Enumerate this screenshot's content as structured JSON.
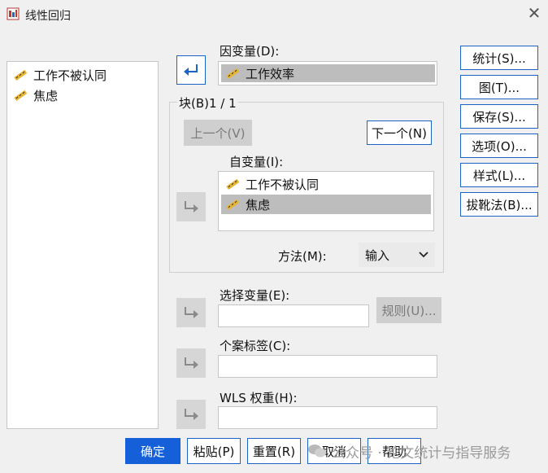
{
  "window": {
    "title": "线性回归",
    "close_glyph": "✕"
  },
  "source_list": {
    "items": [
      {
        "label": "工作不被认同"
      },
      {
        "label": "焦虑"
      }
    ]
  },
  "dependent": {
    "label": "因变量(D):",
    "value": "工作效率"
  },
  "block": {
    "label": "块(B)1 / 1",
    "prev": "上一个(V)",
    "next": "下一个(N)"
  },
  "independent": {
    "label": "自变量(I):",
    "items": [
      {
        "label": "工作不被认同"
      },
      {
        "label": "焦虑"
      }
    ]
  },
  "method": {
    "label": "方法(M):",
    "value": "输入"
  },
  "selection": {
    "label": "选择变量(E):",
    "rule_button": "规则(U)..."
  },
  "case_labels": {
    "label": "个案标签(C):"
  },
  "wls": {
    "label": "WLS 权重(H):"
  },
  "side_buttons": {
    "statistics": "统计(S)...",
    "plots": "图(T)...",
    "save": "保存(S)...",
    "options": "选项(O)...",
    "style": "样式(L)...",
    "bootstrap": "拔靴法(B)..."
  },
  "bottom_buttons": {
    "ok": "确定",
    "paste": "粘贴(P)",
    "reset": "重置(R)",
    "cancel": "取消",
    "help": "帮助"
  },
  "watermark": {
    "text": "公众号 · 论文统计与指导服务"
  },
  "colors": {
    "accent": "#1560d8",
    "border_blue": "#1a63c7",
    "selected_row": "#bdbdbd"
  }
}
